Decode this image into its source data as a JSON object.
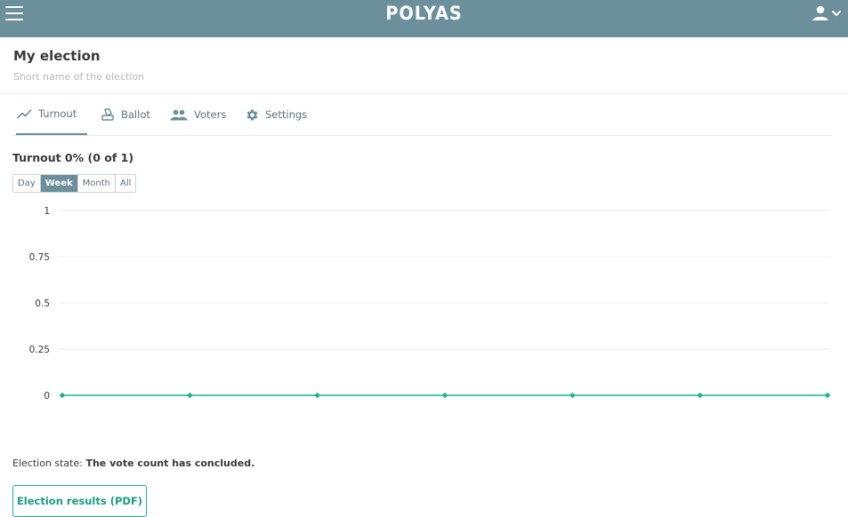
{
  "app": {
    "logo_text": "POLYAS"
  },
  "election": {
    "title": "My election",
    "subtitle": "Short name of the election"
  },
  "tabs": [
    {
      "label": "Turnout",
      "icon": "trend-line-icon",
      "active": true
    },
    {
      "label": "Ballot",
      "icon": "ballot-box-icon",
      "active": false
    },
    {
      "label": "Voters",
      "icon": "people-icon",
      "active": false
    },
    {
      "label": "Settings",
      "icon": "gear-icon",
      "active": false
    }
  ],
  "turnout": {
    "heading": "Turnout 0% (0 of 1)",
    "ranges": [
      "Day",
      "Week",
      "Month",
      "All"
    ],
    "selected_range": "Week"
  },
  "chart_data": {
    "type": "line",
    "y_ticks": [
      "1",
      "0.75",
      "0.5",
      "0.25",
      "0"
    ],
    "ylim": [
      0,
      1
    ],
    "series": [
      {
        "values": [
          0,
          0,
          0,
          0,
          0,
          0,
          0
        ]
      }
    ],
    "grid": true,
    "line_color": "#1ab394"
  },
  "status": {
    "label": "Election state:",
    "value": "The vote count has concluded."
  },
  "actions": {
    "results_pdf_label": "Election results (PDF)"
  },
  "colors": {
    "header": "#6b8f9b",
    "accent": "#1ab394"
  }
}
